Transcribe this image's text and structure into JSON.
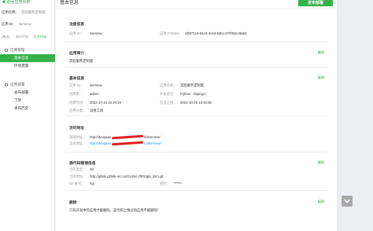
{
  "sidebar": {
    "back_label": "◀ 返回应用列表",
    "app_name_key": "应用名称：",
    "app_name_value": "流程服务定制版",
    "app_id_key": "应用 ID：",
    "app_id_value": "itsmnew",
    "envs": [
      "(集成)",
      "测试环境",
      "正式环境"
    ],
    "groups": [
      {
        "title": "应用管理",
        "items": [
          "基本信息",
          "环境变量"
        ]
      },
      {
        "title": "应用部署",
        "items": [
          "发布部署",
          "下架",
          "发布历史"
        ]
      }
    ]
  },
  "header": {
    "title": "基本信息",
    "deploy_label": "发布部署"
  },
  "registration": {
    "title": "注册信息",
    "app_id_key": "应用 ID：",
    "app_id_value": "itsmnew",
    "token_key": "应用 TOKEN：",
    "token_value": "cf897110-b543-4c6d-82bc-670f92ec5b94"
  },
  "intro": {
    "title": "应用简介",
    "edit_label": "编辑",
    "text": "流程服务定制版"
  },
  "basic": {
    "title": "基本信息",
    "edit_label": "编辑",
    "rows": [
      {
        "k1": "应用 ID：",
        "v1": "itsmnew",
        "k2": "应用名称：",
        "v2": "流程服务定制版"
      },
      {
        "k1": "创建者：",
        "v1": "admin",
        "k2": "开发语言：",
        "v2": "Python（Django）"
      },
      {
        "k1": "创建时间：",
        "v1": "2022-10-19 16:19:19",
        "k2": "首次上线：",
        "v2": "2022-10-25 10:46:35"
      },
      {
        "k1": "应用分类：",
        "v1": "运维工具",
        "k2": "",
        "v2": ""
      }
    ]
  },
  "access": {
    "title": "访问地址",
    "test_key": "测试地址：",
    "test_value": "http://devpaas",
    "test_suffix": "/t/itsmnew/",
    "prod_key": "正式地址：",
    "prod_value": "http://devpaas",
    "prod_suffix": "/o/itsmnew/"
  },
  "source": {
    "title": "源代码管理信息",
    "edit_label": "编辑",
    "repo_type_key": "仓库类型：",
    "repo_type_value": "Git",
    "repo_url_key": "仓库地址：",
    "repo_url_value": "http://gitlab.g2link-inc.cn/GLINK-OPS/glp_itsm.git",
    "account_key": "Git 帐号：",
    "account_value": "hgl",
    "password_key": "密码：",
    "password_value": "******"
  },
  "delete": {
    "title": "删除",
    "edit_label": "编辑",
    "text": "只有开发中的应用才能删除，是否和上线过的应用不能删除！"
  },
  "colors": {
    "accent": "#36b24a",
    "link": "#1890ff",
    "redact": "#e02020"
  },
  "icons": [
    "app-manage-icon",
    "app-deploy-icon",
    "chevron-down-icon"
  ]
}
